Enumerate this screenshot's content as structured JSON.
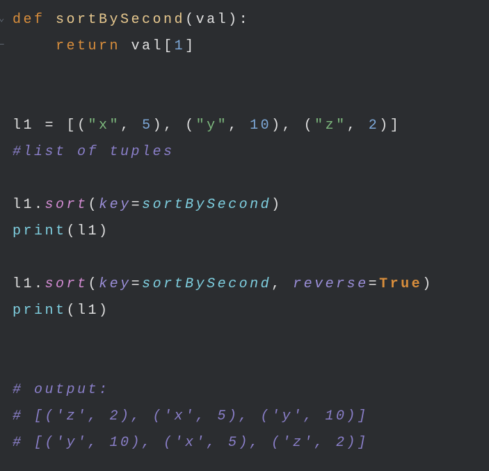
{
  "code": {
    "lines": [
      {
        "type": "def",
        "def_kw": "def",
        "fn_name": "sortBySecond",
        "open": "(",
        "param": "val",
        "close": "):"
      },
      {
        "type": "return",
        "indent": "    ",
        "return_kw": "return",
        "sp": " ",
        "ident": "val",
        "br_open": "[",
        "num": "1",
        "br_close": "]"
      },
      {
        "type": "blank"
      },
      {
        "type": "blank"
      },
      {
        "type": "assign_list",
        "ident": "l1",
        "eq": " = ",
        "open": "[(",
        "s1": "\"x\"",
        "c1": ", ",
        "n1": "5",
        "mid1": "), (",
        "s2": "\"y\"",
        "c2": ", ",
        "n2": "10",
        "mid2": "), (",
        "s3": "\"z\"",
        "c3": ", ",
        "n3": "2",
        "close": ")]"
      },
      {
        "type": "comment",
        "text": "#list of tuples"
      },
      {
        "type": "blank"
      },
      {
        "type": "method_call",
        "ident": "l1",
        "dot": ".",
        "method": "sort",
        "open": "(",
        "kwarg": "key",
        "eq": "=",
        "fn": "sortBySecond",
        "close": ")"
      },
      {
        "type": "print",
        "builtin": "print",
        "open": "(",
        "arg": "l1",
        "close": ")"
      },
      {
        "type": "blank"
      },
      {
        "type": "method_call2",
        "ident": "l1",
        "dot": ".",
        "method": "sort",
        "open": "(",
        "kwarg1": "key",
        "eq1": "=",
        "fn": "sortBySecond",
        "comma": ", ",
        "kwarg2": "reverse",
        "eq2": "=",
        "bool": "True",
        "close": ")"
      },
      {
        "type": "print",
        "builtin": "print",
        "open": "(",
        "arg": "l1",
        "close": ")"
      },
      {
        "type": "blank"
      },
      {
        "type": "blank"
      },
      {
        "type": "comment",
        "text": "# output:"
      },
      {
        "type": "comment",
        "text": "# [('z', 2), ('x', 5), ('y', 10)]"
      },
      {
        "type": "comment",
        "text": "# [('y', 10), ('x', 5), ('z', 2)]"
      }
    ]
  }
}
